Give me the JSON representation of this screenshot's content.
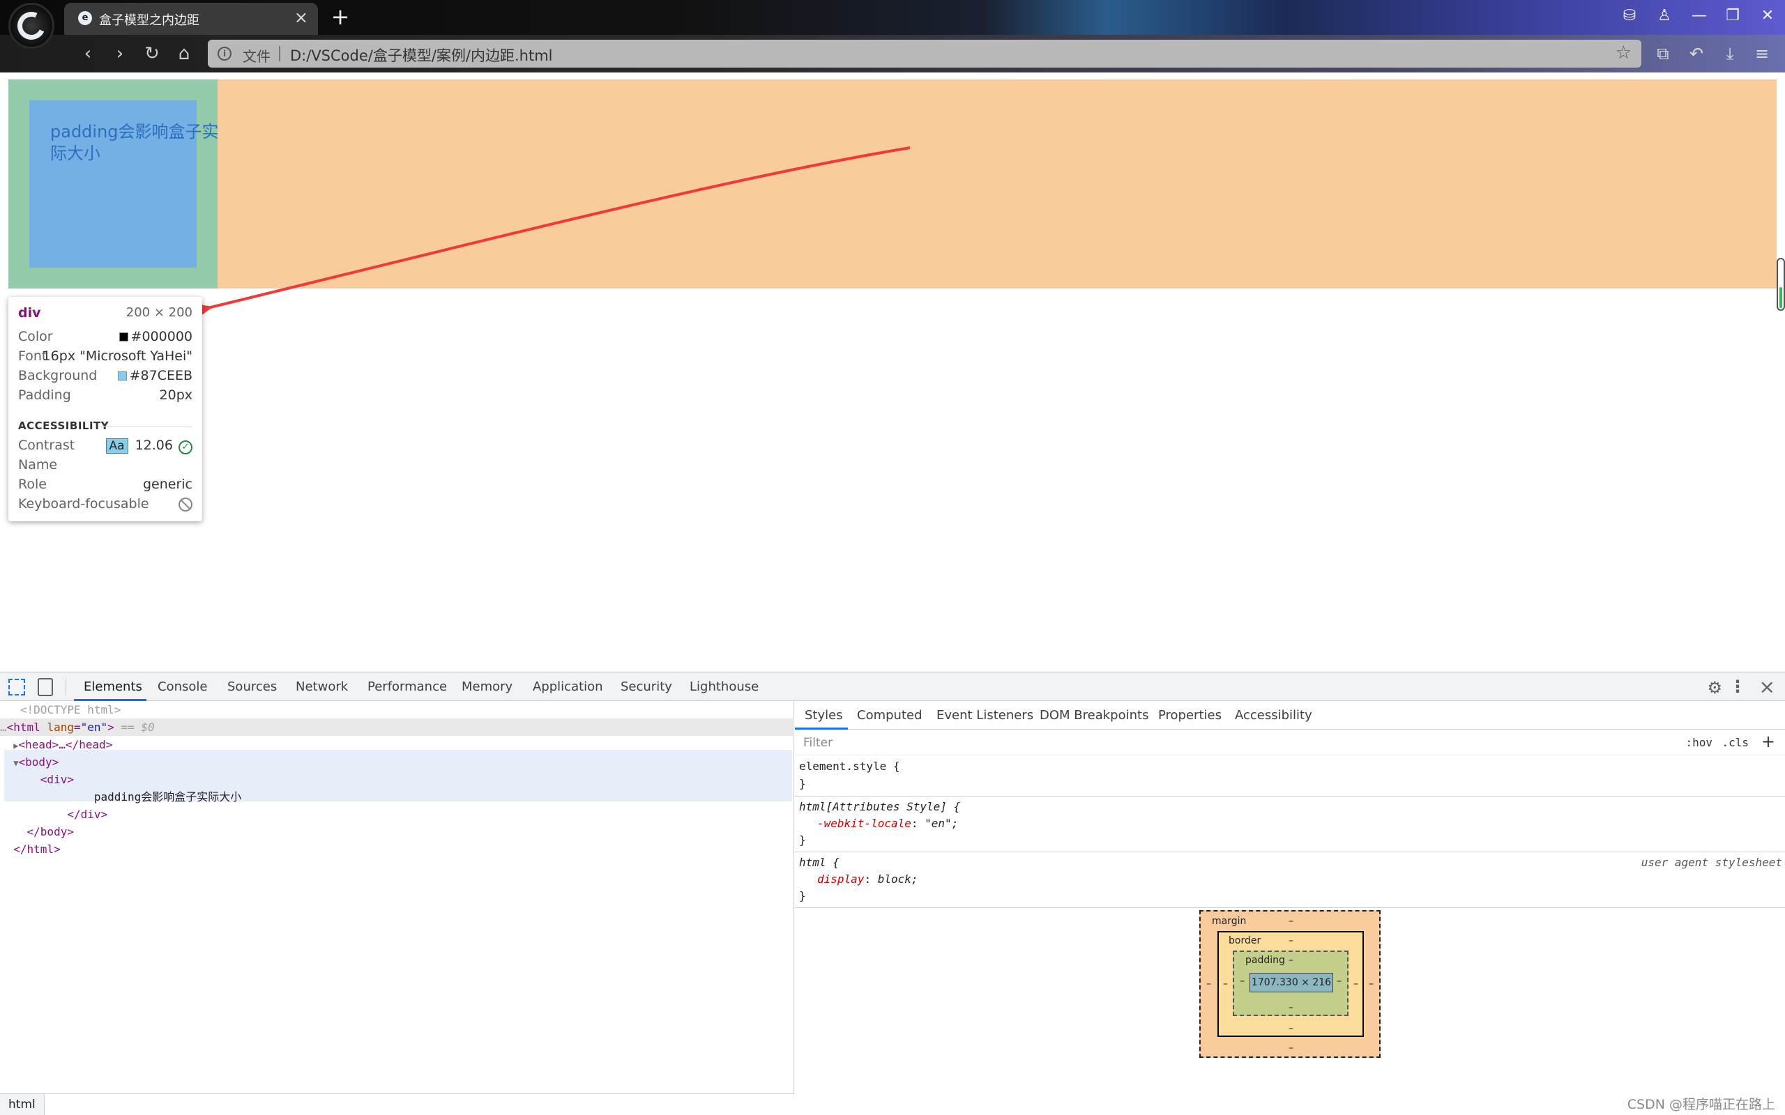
{
  "browser": {
    "tab_title": "盒子模型之内边距",
    "tab_favicon": "e",
    "new_tab": "+",
    "tab_close": "×",
    "address_file_label": "文件",
    "address_url": "D:/VSCode/盒子模型/案例/内边距.html",
    "icons": [
      "browser-logo",
      "collections-icon",
      "shirt-icon",
      "minimize-icon",
      "restore-icon",
      "close-icon",
      "back-icon",
      "forward-icon",
      "refresh-icon",
      "home-icon",
      "info-icon",
      "star-icon",
      "extensions-icon",
      "undo-icon",
      "download-icon",
      "menu-icon"
    ]
  },
  "page": {
    "box_text": "padding会影响盒子实际大小",
    "colors": {
      "body_margin": "#f8cc9c",
      "div_margin": "#93caa9",
      "div_content": "#75b0e4",
      "arrow": "#f03a3a"
    }
  },
  "tooltip": {
    "tag": "div",
    "size": "200 × 200",
    "rows": [
      {
        "key": "Color",
        "value": "#000000",
        "swatch": "#000000"
      },
      {
        "key": "Font",
        "value": "16px \"Microsoft YaHei\""
      },
      {
        "key": "Background",
        "value": "#87CEEB",
        "swatch": "#87CEEB"
      },
      {
        "key": "Padding",
        "value": "20px"
      }
    ],
    "accessibility_heading": "ACCESSIBILITY",
    "contrast_label": "Contrast",
    "contrast_badge": "Aa",
    "contrast_value": "12.06",
    "name_label": "Name",
    "role_label": "Role",
    "role_value": "generic",
    "keyboard_label": "Keyboard-focusable"
  },
  "devtools": {
    "tabs": [
      "Elements",
      "Console",
      "Sources",
      "Network",
      "Performance",
      "Memory",
      "Application",
      "Security",
      "Lighthouse"
    ],
    "dom": {
      "doctype": "<!DOCTYPE html>",
      "html_open_tag": "html",
      "html_attr_name": "lang",
      "html_attr_value": "\"en\"",
      "html_suffix": "== $0",
      "head_collapsed": "<head>…</head>",
      "body_open": "<body>",
      "div_open": "<div>",
      "div_text": "padding会影响盒子实际大小",
      "div_close": "</div>",
      "body_close": "</body>",
      "html_close": "</html>"
    },
    "breadcrumb": "html",
    "styles_tabs": [
      "Styles",
      "Computed",
      "Event Listeners",
      "DOM Breakpoints",
      "Properties",
      "Accessibility"
    ],
    "filter_placeholder": "Filter",
    "hov": ":hov",
    "cls": ".cls",
    "add": "+",
    "rules": {
      "element_style_open": "element.style {",
      "close": "}",
      "attr_style_selector": "html[Attributes Style] {",
      "attr_prop": "-webkit-locale",
      "attr_value": "\"en\";",
      "html_selector": "html {",
      "html_source": "user agent stylesheet",
      "html_prop": "display",
      "html_value": "block;"
    },
    "box_model": {
      "margin_label": "margin",
      "border_label": "border",
      "padding_label": "padding",
      "dash": "–",
      "content_size": "1707.330 × 216"
    }
  },
  "watermark": "CSDN @程序喵正在路上"
}
